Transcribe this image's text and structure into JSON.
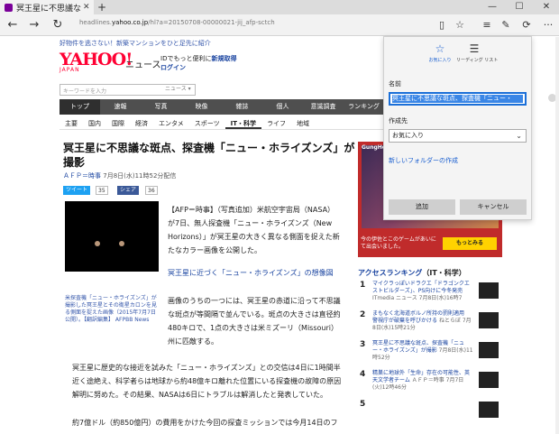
{
  "browser": {
    "tab_title": "冥王星に不思議な斑点、",
    "tab_close": "✕",
    "new_tab": "+",
    "win_min": "—",
    "win_max": "☐",
    "win_close": "✕",
    "address_prefix": "headlines.",
    "address_domain": "yahoo.co.jp",
    "address_rest": "/hl?a=20150708-00000021-jij_afp-sctch",
    "icons": [
      "back-icon",
      "forward-icon",
      "refresh-icon",
      "reading-view-icon",
      "favorites-star-icon",
      "hub-icon",
      "web-note-icon",
      "share-icon",
      "more-icon"
    ]
  },
  "page": {
    "promo": "好物件を逃さない！新築マンションをひと足先に紹介",
    "logo": "YAHOO!",
    "logo_sub": "JAPAN",
    "logo_news": "ニュース",
    "login_line1_prefix": "IDでもっと便利に",
    "login_line1_link": "新規取得",
    "login_line2": "ログイン",
    "search_placeholder": "キーワードを入力",
    "search_category": "ニュース ▾",
    "main_nav": [
      "トップ",
      "速報",
      "写真",
      "映像",
      "雑誌",
      "個人",
      "意識調査",
      "ランキング"
    ],
    "sub_nav": [
      "主要",
      "国内",
      "国際",
      "経済",
      "エンタメ",
      "スポーツ",
      "IT・科学",
      "ライフ",
      "地域"
    ],
    "headline": "冥王星に不思議な斑点、探査機「ニュー・ホライズンズ」が撮影",
    "byline_source": "ＡＦＰ＝時事",
    "byline_date": "7月8日(水)11時52分配信",
    "tweet_label": "ツイート",
    "tweet_count": "35",
    "share_label": "シェア",
    "share_count": "36",
    "caption": "米探査機「ニュー・ホライズンズ」が撮影した冥王星とその衛星カロンを見る側面を捉えた画像（2015年7月7日公開）。【翻訳編集】 AFPBB News",
    "body1": "【AFP＝時事】（写真追加）米航空宇宙局（NASA）が7日、無人探査機「ニュー・ホライズンズ（New Horizons）」が冥王星の大きく異なる側面を捉えた新たなカラー画像を公開した。",
    "related_link": "冥王星に近づく「ニュー・ホライズンズ」の想像図",
    "body2": "画像のうちの一つには、冥王星の赤道に沿って不思議な斑点が等間隔で並んでいる。斑点の大きさは直径約480キロで、1点の大きさは米ミズーリ（Missouri）州に匹敵する。",
    "body3": "冥王星に歴史的な接近を試みた「ニュー・ホライズンズ」との交信は4日に1時間半近く途絶え、科学者らは地球から約48億キロ離れた位置にいる探査機の故障の原因解明に努めた。その結果、NASAは6日にトラブルは解消したと発表していた。",
    "body4": "約7億ドル（約850億円）の費用をかけた今回の探査ミッションでは今月14日のフ"
  },
  "sidebar": {
    "ad_brand": "GungHo",
    "ad_text": "今の伊佐とこのゲームがあいにて出会いました。",
    "ad_button": "もっとみる",
    "ranking_title": "アクセスランキング",
    "ranking_category": "（IT・科学）",
    "ranking": [
      {
        "num": "1",
        "text": "マイクラっぽいドラクエ「ドラゴンクエストビルダーズ」、PS向けに今冬発売",
        "meta": "ITmedia ニュース 7月8日(水)16時7"
      },
      {
        "num": "2",
        "text": "まもなく北海道ボルノ所持の罰則適用　警視庁が破棄を呼びかける",
        "meta": "ねとらぼ 7月8日(水)15時21分"
      },
      {
        "num": "3",
        "text": "冥王星に不思議な斑点、探査機「ニュー・ホライズンズ」が撮影",
        "meta": "7月8日(水)11時52分"
      },
      {
        "num": "4",
        "text": "精巣に地球外「生命」存在の可能性、英天文学者チーム",
        "meta": "ＡＦＰ＝時事 7月7日(火)12時46分"
      },
      {
        "num": "5",
        "text": "",
        "meta": ""
      }
    ]
  },
  "favorites_flyout": {
    "tab_favorites": "お気に入り",
    "tab_reading_list": "リーディング リスト",
    "name_label": "名前",
    "name_value": "冥王星に不思議な斑点、探査機「ニュー・",
    "save_in_label": "作成先",
    "save_in_value": "お気に入り",
    "new_folder_link": "新しいフォルダーの作成",
    "add_button": "追加",
    "cancel_button": "キャンセル"
  }
}
